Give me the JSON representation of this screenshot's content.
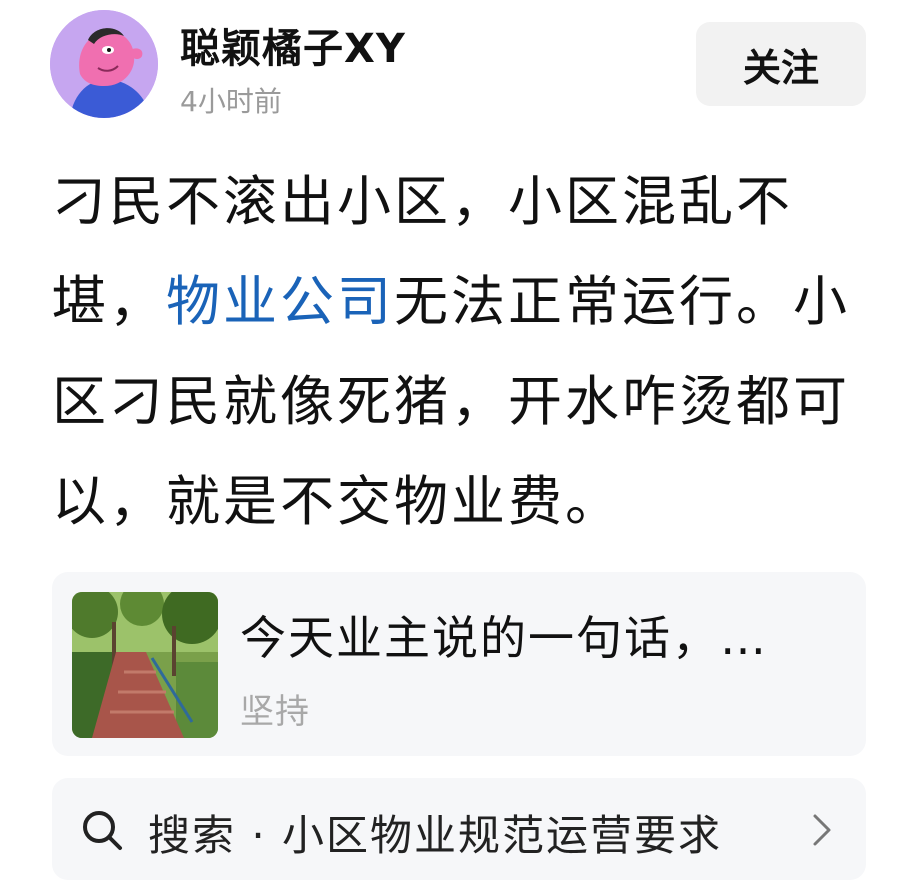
{
  "header": {
    "username": "聪颖橘子XY",
    "timestamp": "4小时前",
    "follow_label": "关注"
  },
  "post": {
    "text_before": "刁民不滚出小区，小区混乱不堪，",
    "link_text": "物业公司",
    "text_after": "无法正常运行。小区刁民就像死猪，开水咋烫都可以，就是不交物业费。"
  },
  "card": {
    "title": "今天业主说的一句话，…",
    "subtitle": "坚持",
    "thumbnail_icon": "park-path-photo"
  },
  "search": {
    "label": "搜索 · 小区物业规范运营要求",
    "icon": "search-icon",
    "chevron": "chevron-right-icon"
  },
  "colors": {
    "link": "#1a63b8",
    "muted": "#9a9a9a",
    "card_bg": "#f6f7f9",
    "button_bg": "#f2f2f2"
  }
}
